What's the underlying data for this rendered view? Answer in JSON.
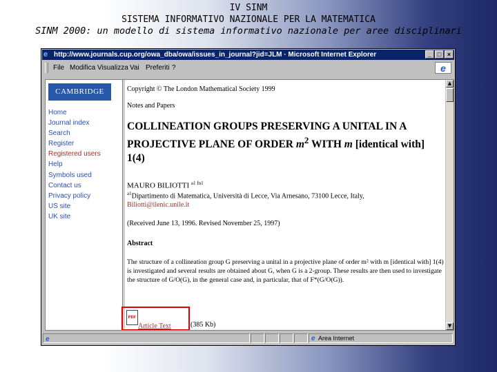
{
  "slide": {
    "title_line1": "IV SINM",
    "title_line2": "SISTEMA INFORMATIVO NAZIONALE PER LA MATEMATICA",
    "title_line3": "SINM 2000: un modello di sistema informativo nazionale per aree disciplinari"
  },
  "window": {
    "title": "http://www.journals.cup.org/owa_dba/owa/issues_in_journal?jid=JLM · Microsoft Internet Explorer",
    "minimize": "_",
    "maximize": "□",
    "close": "×"
  },
  "menubar": {
    "items": [
      "File",
      "Modifica",
      "Visualizza",
      "Vai",
      "Preferiti",
      "?"
    ]
  },
  "sidebar": {
    "logo": "CAMBRIDGE",
    "items": [
      {
        "label": "Home"
      },
      {
        "label": "Journal index"
      },
      {
        "label": "Search"
      },
      {
        "label": "Register"
      },
      {
        "label": "Registered users"
      },
      {
        "label": "Help"
      },
      {
        "label": "Symbols used"
      },
      {
        "label": "Contact us"
      },
      {
        "label": "Privacy policy"
      },
      {
        "label": "US site"
      },
      {
        "label": "UK site"
      }
    ]
  },
  "article": {
    "copyright": "Copyright © The London Mathematical Society 1999",
    "section": "Notes and Papers",
    "title_part1": "COLLINEATION GROUPS PRESERVING A UNITAL IN A PROJECTIVE PLANE OF ORDER ",
    "title_m2": "m",
    "title_sup": "2",
    "title_part2": " WITH ",
    "title_m": "m",
    "title_part3": " [identical with] 1(4)",
    "author": "MAURO BILIOTTI",
    "author_sup": "a1 fn1",
    "affiliation_sup": "a1",
    "affiliation": "Dipartimento di Matematica, Università di Lecce, Via Arnesano, 73100 Lecce, Italy,",
    "email": "Biliotti@ilenic.unile.it",
    "received": "(Received June 13, 1996. Revised November 25, 1997)",
    "abstract_heading": "Abstract",
    "abstract_text": "The structure of a collineation group G preserving a unital in a projective plane of order m² with m [identical with] 1(4) is investigated and several results are obtained about G, when G is a 2-group. These results are then used to investigate the structure of G/O(G), in the general case and, in particular, that of F*(G/O(G)).",
    "pdf_icon": "PDF",
    "pdf_link": "Article Text",
    "pdf_size": "(385 Kb)"
  },
  "statusbar": {
    "zone": "Area Internet"
  }
}
